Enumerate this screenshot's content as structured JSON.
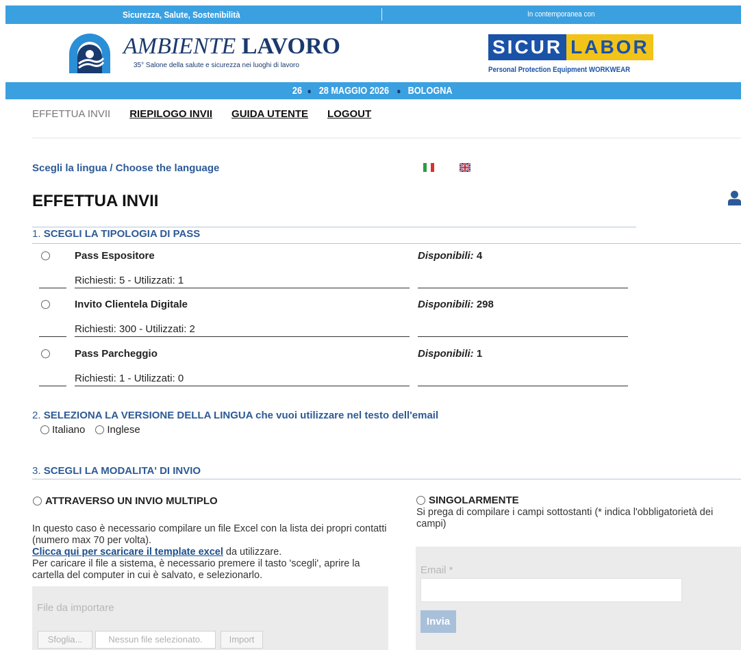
{
  "header": {
    "top_left": "Sicurezza, Salute, Sostenibilità",
    "top_right": "In contemporanea con",
    "ambiente_italic": "AMBIENTE",
    "ambiente_bold": "LAVORO",
    "ambiente_sub": "35° Salone della salute e sicurezza nei luoghi di lavoro",
    "sicur_1": "SICUR",
    "sicur_2": "LABOR",
    "sicur_sub": "Personal Protection Equipment WORKWEAR",
    "date_1": "26",
    "date_2": "28 MAGGIO 2026",
    "date_3": "BOLOGNA"
  },
  "nav": {
    "items": [
      "EFFETTUA INVII",
      "RIEPILOGO INVII",
      "GUIDA UTENTE",
      "LOGOUT"
    ],
    "active": "EFFETTUA INVII"
  },
  "language": {
    "prompt": "Scegli la lingua / Choose the language"
  },
  "page": {
    "title": "EFFETTUA INVII"
  },
  "section1": {
    "number": "1.",
    "title": "SCEGLI LA TIPOLOGIA DI PASS",
    "disp_label": "Disponibili:",
    "passes": [
      {
        "name": "Pass Espositore",
        "available": "4",
        "details": "Richiesti: 5 - Utilizzati: 1"
      },
      {
        "name": "Invito Clientela Digitale",
        "available": "298",
        "details": "Richiesti: 300 - Utilizzati: 2"
      },
      {
        "name": "Pass Parcheggio",
        "available": "1",
        "details": "Richiesti: 1 - Utilizzati: 0"
      }
    ]
  },
  "section2": {
    "number": "2.",
    "title": "SELEZIONA LA VERSIONE DELLA LINGUA che vuoi utilizzare nel testo dell'email",
    "options": [
      "Italiano",
      "Inglese"
    ]
  },
  "section3": {
    "number": "3.",
    "title": "SCEGLI LA MODALITA' DI INVIO",
    "multi": {
      "title": "ATTRAVERSO UN INVIO MULTIPLO",
      "text1": "In questo caso è necessario compilare un file Excel con la lista dei propri contatti (numero max 70 per volta).",
      "link": "Clicca qui per scaricare il template excel",
      "link_after": " da utilizzare.",
      "text2": "Per caricare il file a sistema, è necessario premere il tasto 'scegli', aprire la cartella del computer in cui è salvato, e selezionarlo.",
      "file_label": "File da importare",
      "browse": "Sfoglia...",
      "no_file": "Nessun file selezionato.",
      "import": "Import"
    },
    "single": {
      "title": "SINGOLARMENTE",
      "text": "Si prega di compilare i campi sottostanti (* indica l'obbligatorietà dei campi)",
      "email_label": "Email *",
      "submit": "Invia"
    }
  },
  "colors": {
    "accent_blue": "#3ba0e0",
    "section_blue": "#2d5a96",
    "sicur_blue": "#1a52a8",
    "labor_yellow": "#f2c318"
  }
}
